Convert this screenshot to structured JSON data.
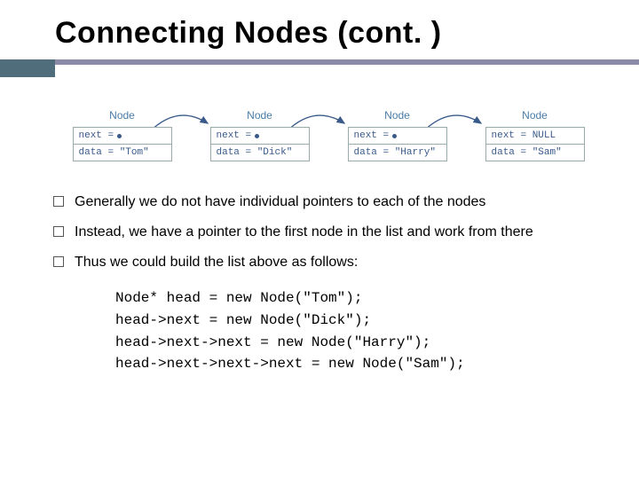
{
  "title": "Connecting Nodes (cont. )",
  "diagram": {
    "node_label": "Node",
    "nodes": [
      {
        "next": "next =",
        "data": "data = \"Tom\""
      },
      {
        "next": "next =",
        "data": "data = \"Dick\""
      },
      {
        "next": "next =",
        "data": "data = \"Harry\""
      },
      {
        "next": "next = NULL",
        "data": "data = \"Sam\""
      }
    ]
  },
  "bullets": [
    "Generally we do not have individual pointers to each of the nodes",
    "Instead, we have a pointer to the first node in the list and work from there",
    "Thus we could build the list above as follows:"
  ],
  "code": "Node* head = new Node(\"Tom\");\nhead->next = new Node(\"Dick\");\nhead->next->next = new Node(\"Harry\");\nhead->next->next->next = new Node(\"Sam\");"
}
